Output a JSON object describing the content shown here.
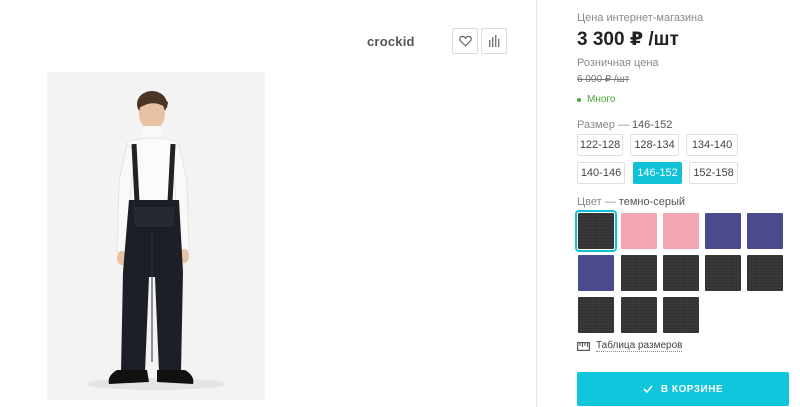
{
  "brand": {
    "name": "crockid"
  },
  "actions": {
    "favorite_icon": "heart-icon",
    "compare_icon": "bar-chart-icon"
  },
  "price": {
    "online_label": "Цена интернет-магазина",
    "online_value": "3 300 ₽ /шт",
    "retail_label": "Розничная цена",
    "retail_value": "6 000 ₽ /шт"
  },
  "stock": {
    "label": "Много",
    "color": "#4aa83a"
  },
  "size": {
    "label": "Размер",
    "selected": "146-152",
    "options": [
      "122-128",
      "128-134",
      "134-140",
      "140-146",
      "146-152",
      "152-158"
    ]
  },
  "color": {
    "label": "Цвет",
    "selected": "темно-серый",
    "swatches": [
      "#3a3a3a",
      "#f2a6b0",
      "#f2a6b0",
      "#4b4a8c",
      "#4b4a8c",
      "#4b4a8c",
      "#3a3a3a",
      "#3a3a3a",
      "#3a3a3a",
      "#3a3a3a",
      "#3a3a3a",
      "#3a3a3a",
      "#3a3a3a"
    ]
  },
  "size_table": {
    "label": "Таблица размеров"
  },
  "cart": {
    "label": "В КОРЗИНЕ"
  },
  "accent_color": "#10c6dc"
}
